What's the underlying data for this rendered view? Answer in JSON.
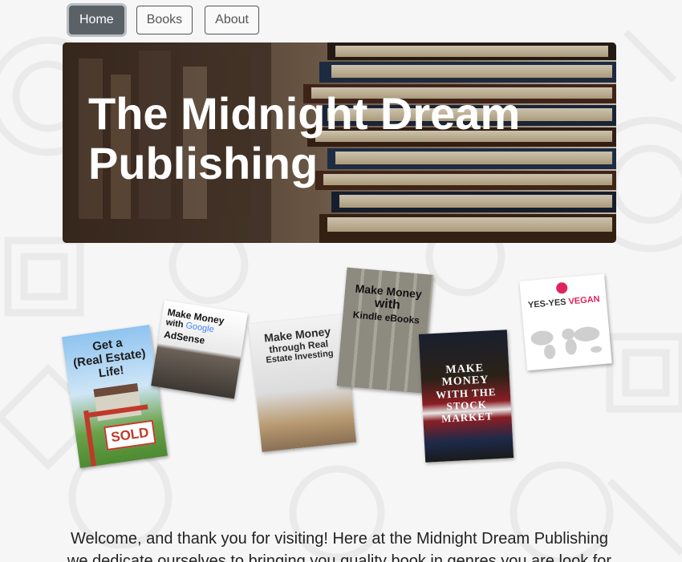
{
  "nav": {
    "items": [
      {
        "label": "Home",
        "active": true
      },
      {
        "label": "Books",
        "active": false
      },
      {
        "label": "About",
        "active": false
      }
    ]
  },
  "hero": {
    "title": "The Midnight Dream Publishing"
  },
  "books": {
    "real_estate": {
      "line1": "Get a",
      "line2": "(Real Estate)",
      "line3": "Life!",
      "sign": "SOLD"
    },
    "adsense": {
      "line1": "Make Money",
      "line2": "with",
      "brand": "Google",
      "line3": "AdSense"
    },
    "investing": {
      "line1": "Make Money",
      "line2": "through Real",
      "line3": "Estate Investing"
    },
    "kindle": {
      "line1": "Make Money",
      "line2": "with",
      "line3": "Kindle eBooks"
    },
    "stock": {
      "line1": "MAKE",
      "line2": "MONEY",
      "line3": "WITH THE",
      "line4": "STOCK",
      "line5": "MARKET"
    },
    "vegan": {
      "title_a": "YES-YES",
      "title_b": "VEGAN"
    }
  },
  "welcome": {
    "text": "Welcome, and thank you for visiting! Here at the Midnight Dream Publishing we dedicate ourselves to bringing you quality book in genres you are look for"
  },
  "colors": {
    "nav_active_bg": "#5a6268",
    "page_bg": "#f6f6f6",
    "hero_title": "#ffffff"
  }
}
